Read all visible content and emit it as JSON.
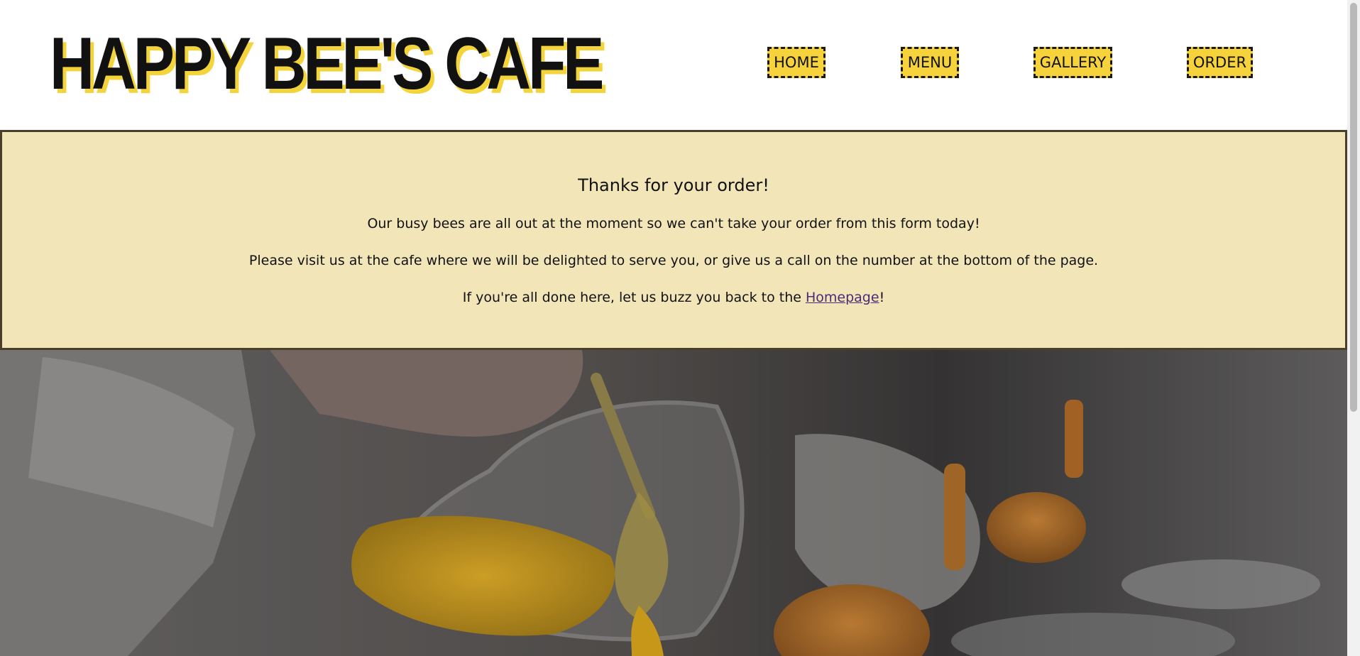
{
  "brand": {
    "name": "HAPPY BEE'S CAFE",
    "accent_color": "#f6d33a",
    "panel_color": "#f2e6b8"
  },
  "nav": {
    "items": [
      {
        "label": "HOME"
      },
      {
        "label": "MENU"
      },
      {
        "label": "GALLERY"
      },
      {
        "label": "ORDER"
      }
    ]
  },
  "confirmation": {
    "title": "Thanks for your order!",
    "line1": "Our busy bees are all out at the moment so we can't take your order from this form today!",
    "line2": "Please visit us at the cafe where we will be delighted to serve you, or give us a call on the number at the bottom of the page.",
    "line3_prefix": "If you're all done here, let us buzz you back to the ",
    "line3_link": "Homepage",
    "line3_suffix": "!"
  }
}
